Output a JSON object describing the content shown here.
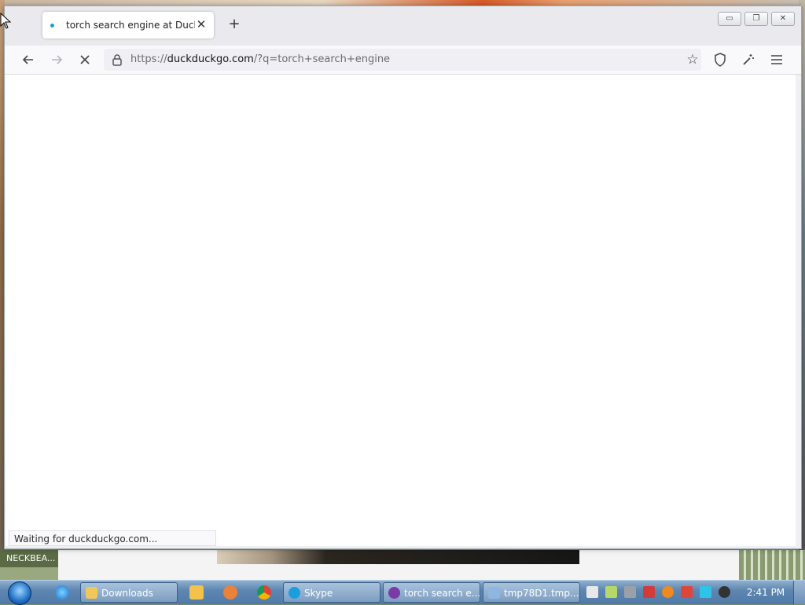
{
  "browser": {
    "tab": {
      "title": "torch search engine at DuckDuc",
      "close_icon": "close-icon"
    },
    "new_tab_label": "+",
    "window_controls": {
      "minimize": "minimize-icon",
      "restore": "restore-icon",
      "close": "close-icon"
    },
    "nav": {
      "back_icon": "arrow-left-icon",
      "forward_icon": "arrow-right-icon",
      "stop_icon": "stop-loading-icon"
    },
    "url": {
      "scheme": "https://",
      "host": "duckduckgo.com",
      "path": "/?q=torch+search+engine"
    },
    "status_text": "Waiting for duckduckgo.com..."
  },
  "desktop": {
    "label": "NECKBEA..."
  },
  "taskbar": {
    "buttons": [
      {
        "label": "Downloads",
        "icon": "folder-icon"
      },
      {
        "label": "Skype",
        "icon": "skype-icon"
      },
      {
        "label": "torch search e...",
        "icon": "tor-browser-icon"
      },
      {
        "label": "tmp78D1.tmp....",
        "icon": "image-viewer-icon"
      }
    ],
    "clock": "2:41 PM"
  },
  "colors": {
    "tab_indicator": "#1d9bd8",
    "taskbar": "#5f86b1"
  }
}
